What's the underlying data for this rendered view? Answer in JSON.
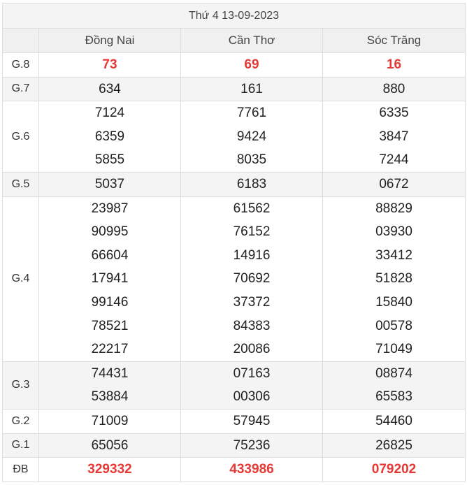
{
  "title": "Thứ 4 13-09-2023",
  "provinces": [
    "Đồng Nai",
    "Cần Thơ",
    "Sóc Trăng"
  ],
  "colors": {
    "highlight": "#e53935",
    "alt_row": "#f4f4f4",
    "header_bg": "#f0f0f0",
    "border": "#dddddd"
  },
  "rows": [
    {
      "label": "G.8",
      "highlight": true,
      "alt": false,
      "values": [
        [
          "73"
        ],
        [
          "69"
        ],
        [
          "16"
        ]
      ]
    },
    {
      "label": "G.7",
      "highlight": false,
      "alt": true,
      "values": [
        [
          "634"
        ],
        [
          "161"
        ],
        [
          "880"
        ]
      ]
    },
    {
      "label": "G.6",
      "highlight": false,
      "alt": false,
      "values": [
        [
          "7124",
          "6359",
          "5855"
        ],
        [
          "7761",
          "9424",
          "8035"
        ],
        [
          "6335",
          "3847",
          "7244"
        ]
      ]
    },
    {
      "label": "G.5",
      "highlight": false,
      "alt": true,
      "values": [
        [
          "5037"
        ],
        [
          "6183"
        ],
        [
          "0672"
        ]
      ]
    },
    {
      "label": "G.4",
      "highlight": false,
      "alt": false,
      "values": [
        [
          "23987",
          "90995",
          "66604",
          "17941",
          "99146",
          "78521",
          "22217"
        ],
        [
          "61562",
          "76152",
          "14916",
          "70692",
          "37372",
          "84383",
          "20086"
        ],
        [
          "88829",
          "03930",
          "33412",
          "51828",
          "15840",
          "00578",
          "71049"
        ]
      ]
    },
    {
      "label": "G.3",
      "highlight": false,
      "alt": true,
      "values": [
        [
          "74431",
          "53884"
        ],
        [
          "07163",
          "00306"
        ],
        [
          "08874",
          "65583"
        ]
      ]
    },
    {
      "label": "G.2",
      "highlight": false,
      "alt": false,
      "values": [
        [
          "71009"
        ],
        [
          "57945"
        ],
        [
          "54460"
        ]
      ]
    },
    {
      "label": "G.1",
      "highlight": false,
      "alt": true,
      "values": [
        [
          "65056"
        ],
        [
          "75236"
        ],
        [
          "26825"
        ]
      ]
    },
    {
      "label": "ĐB",
      "highlight": true,
      "alt": false,
      "values": [
        [
          "329332"
        ],
        [
          "433986"
        ],
        [
          "079202"
        ]
      ]
    }
  ]
}
